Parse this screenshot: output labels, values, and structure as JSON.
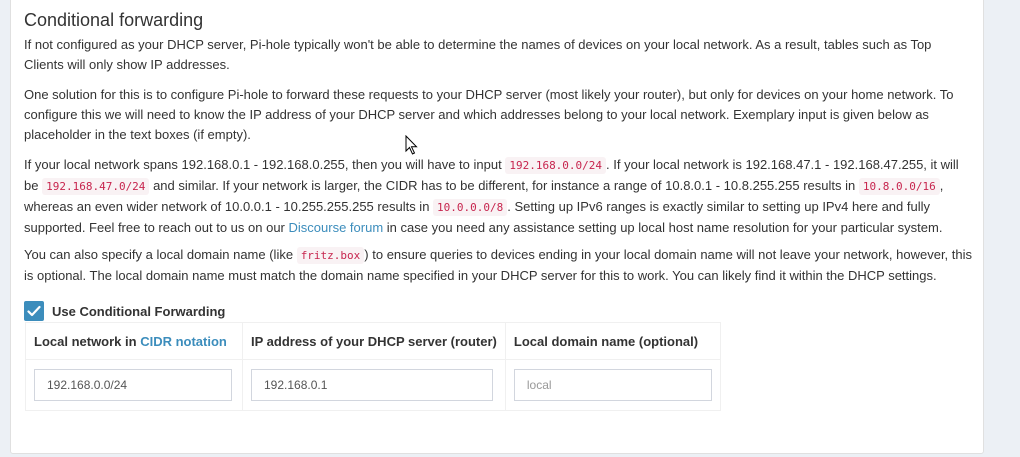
{
  "section": {
    "title": "Conditional forwarding",
    "p1": "If not configured as your DHCP server, Pi-hole typically won't be able to determine the names of devices on your local network. As a result, tables such as Top Clients will only show IP addresses.",
    "p2": "One solution for this is to configure Pi-hole to forward these requests to your DHCP server (most likely your router), but only for devices on your home network. To configure this we will need to know the IP address of your DHCP server and which addresses belong to your local network. Exemplary input is given below as placeholder in the text boxes (if empty).",
    "p3": {
      "t1": "If your local network spans 192.168.0.1 - 192.168.0.255, then you will have to input",
      "c1": "192.168.0.0/24",
      "t2": ". If your local network is 192.168.47.1 - 192.168.47.255, it will be",
      "c2": "192.168.47.0/24",
      "t3": "and similar. If your network is larger, the CIDR has to be different, for instance a range of 10.8.0.1 - 10.8.255.255 results in",
      "c3": "10.8.0.0/16",
      "t4": ", whereas an even wider network of 10.0.0.1 - 10.255.255.255 results in",
      "c4": "10.0.0.0/8",
      "t5": ". Setting up IPv6 ranges is exactly similar to setting up IPv4 here and fully supported. Feel free to reach out to us on our",
      "link": "Discourse forum",
      "t6": "in case you need any assistance setting up local host name resolution for your particular system."
    },
    "p4": {
      "t1": "You can also specify a local domain name (like",
      "c1": "fritz.box",
      "t2": ") to ensure queries to devices ending in your local domain name will not leave your network, however, this is optional. The local domain name must match the domain name specified in your DHCP server for this to work. You can likely find it within the DHCP settings."
    },
    "checkbox": {
      "label": "Use Conditional Forwarding",
      "checked": true
    },
    "table": {
      "h1_prefix": "Local network in",
      "h1_link": "CIDR notation",
      "h2": "IP address of your DHCP server (router)",
      "h3": "Local domain name (optional)",
      "network_value": "192.168.0.0/24",
      "dhcp_value": "192.168.0.1",
      "domain_placeholder": "local"
    }
  },
  "colors": {
    "accent": "#3c8dbc",
    "code": "#c7254e",
    "code_bg": "#f9f2f4"
  }
}
